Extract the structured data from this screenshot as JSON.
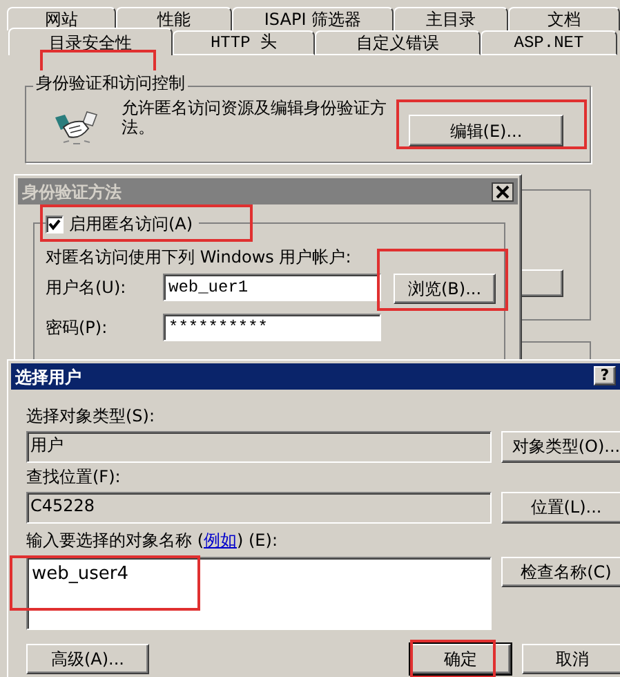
{
  "properties_dialog": {
    "tabs_back": [
      {
        "label": "网站",
        "selected": false
      },
      {
        "label": "性能",
        "selected": false
      },
      {
        "label": "ISAPI 筛选器",
        "selected": false
      },
      {
        "label": "主目录",
        "selected": false
      },
      {
        "label": "文档",
        "selected": false
      }
    ],
    "tabs_front": [
      {
        "label": "目录安全性",
        "selected": true,
        "highlighted": true
      },
      {
        "label": "HTTP 头",
        "selected": false,
        "highlighted": false
      },
      {
        "label": "自定义错误",
        "selected": false,
        "highlighted": false
      },
      {
        "label": "ASP.NET",
        "selected": false,
        "highlighted": false
      }
    ],
    "auth_group": {
      "title": "身份验证和访问控制",
      "description": "允许匿名访问资源及编辑身份验证方法。",
      "button": {
        "label": "编辑(E)...",
        "highlighted": true
      }
    }
  },
  "auth_dialog": {
    "title": "身份验证方法",
    "anonymous": {
      "label": "启用匿名访问(A)",
      "checked": true,
      "highlighted": true
    },
    "account_caption": "对匿名访问使用下列 Windows 用户帐户:",
    "fields": [
      {
        "label": "用户名(U):",
        "value": "web_uer1"
      },
      {
        "label": "密码(P):",
        "value": "**********"
      }
    ],
    "browse_button": {
      "label": "浏览(B)...",
      "highlighted": true
    }
  },
  "select_user_dialog": {
    "title": "选择用户",
    "help": "?",
    "object_type": {
      "label": "选择对象类型(S):",
      "value": "用户",
      "button": "对象类型(O)..."
    },
    "location": {
      "label": "查找位置(F):",
      "value": "C45228",
      "button": "位置(L)..."
    },
    "names": {
      "label_before": "输入要选择的对象名称 (",
      "link": "例如",
      "label_after": ") (E):",
      "value": "web_user4",
      "highlighted": true,
      "button": "检查名称(C)"
    },
    "buttons": [
      {
        "label": "高级(A)...",
        "highlighted": false
      },
      {
        "label": "确定",
        "highlighted": true
      },
      {
        "label": "取消",
        "highlighted": false
      }
    ]
  }
}
